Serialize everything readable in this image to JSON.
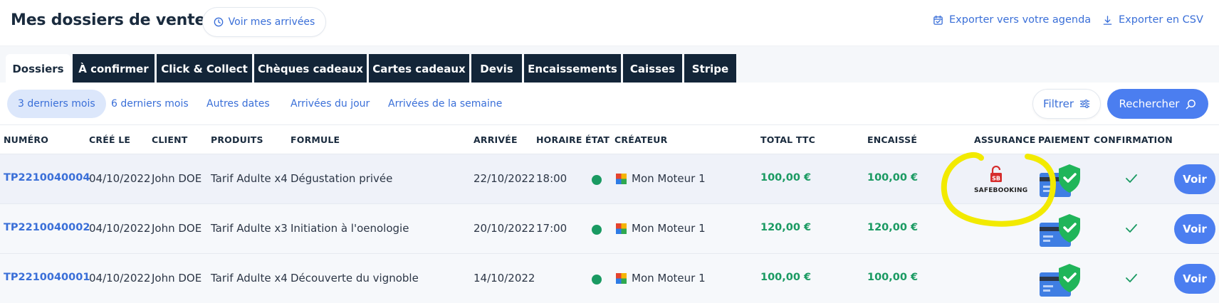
{
  "header": {
    "title": "Mes dossiers de vente",
    "arrivals_label": "Voir mes arrivées",
    "agenda_label": "Exporter vers votre agenda",
    "csv_label": "Exporter en CSV"
  },
  "tabs": [
    {
      "label": "Dossiers",
      "active": true
    },
    {
      "label": "À confirmer"
    },
    {
      "label": "Click & Collect"
    },
    {
      "label": "Chèques cadeaux"
    },
    {
      "label": "Cartes cadeaux"
    },
    {
      "label": "Devis"
    },
    {
      "label": "Encaissements"
    },
    {
      "label": "Caisses"
    },
    {
      "label": "Stripe"
    }
  ],
  "filters": {
    "periods": [
      "3 derniers mois",
      "6 derniers mois",
      "Autres dates",
      "Arrivées du jour",
      "Arrivées de la semaine"
    ],
    "filter_label": "Filtrer",
    "search_label": "Rechercher"
  },
  "table": {
    "columns": [
      "NUMÉRO",
      "CRÉÉ LE",
      "CLIENT",
      "PRODUITS",
      "FORMULE",
      "ARRIVÉE",
      "HORAIRE",
      "ÉTAT",
      "CRÉATEUR",
      "TOTAL TTC",
      "ENCAISSÉ",
      "ASSURANCE",
      "PAIEMENT",
      "CONFIRMATION"
    ],
    "rows": [
      {
        "numero": "TP2210040004",
        "cree_le": "04/10/2022",
        "client": "John DOE",
        "produits": "Tarif Adulte x4",
        "formule": "Dégustation privée",
        "arrivee": "22/10/2022",
        "horaire": "18:00",
        "createur": "Mon Moteur 1",
        "total": "100,00 €",
        "encaisse": "100,00 €",
        "assurance": "SAFEBOOKING",
        "voir": "Voir"
      },
      {
        "numero": "TP2210040002",
        "cree_le": "04/10/2022",
        "client": "John DOE",
        "produits": "Tarif Adulte x3",
        "formule": "Initiation à l'oenologie",
        "arrivee": "20/10/2022",
        "horaire": "17:00",
        "createur": "Mon Moteur 1",
        "total": "120,00 €",
        "encaisse": "120,00 €",
        "assurance": "",
        "voir": "Voir"
      },
      {
        "numero": "TP2210040001",
        "cree_le": "04/10/2022",
        "client": "John DOE",
        "produits": "Tarif Adulte x4",
        "formule": "Découverte du vignoble",
        "arrivee": "14/10/2022",
        "horaire": "",
        "createur": "Mon Moteur 1",
        "total": "100,00 €",
        "encaisse": "100,00 €",
        "assurance": "",
        "voir": "Voir"
      }
    ]
  },
  "colors": {
    "accent": "#4b7ef0",
    "link": "#3a6fd8",
    "tab_dark": "#132538",
    "success": "#1a9a62",
    "highlight": "#f2ea00"
  }
}
